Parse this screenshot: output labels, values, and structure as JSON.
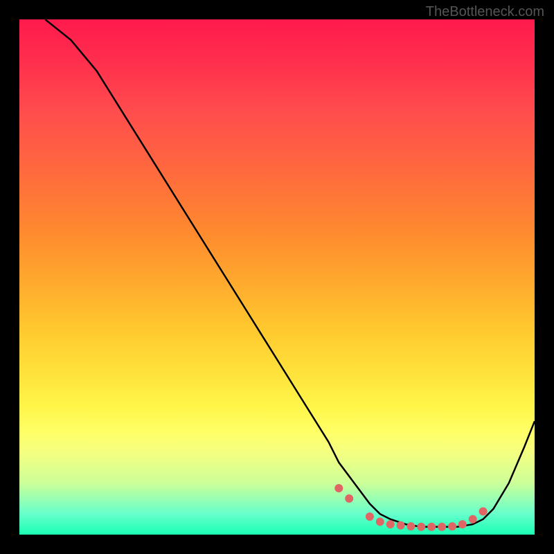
{
  "watermark": "TheBottleneck.com",
  "chart_data": {
    "type": "line",
    "title": "",
    "xlabel": "",
    "ylabel": "",
    "xlim": [
      0,
      100
    ],
    "ylim": [
      0,
      100
    ],
    "series": [
      {
        "name": "curve",
        "x": [
          5,
          10,
          15,
          20,
          25,
          30,
          35,
          40,
          45,
          50,
          55,
          60,
          62,
          65,
          68,
          70,
          72,
          75,
          78,
          80,
          82,
          85,
          88,
          90,
          92,
          95,
          98,
          100
        ],
        "y": [
          100,
          96,
          90,
          82,
          74,
          66,
          58,
          50,
          42,
          34,
          26,
          18,
          14,
          10,
          6,
          4,
          3,
          2,
          1.5,
          1.5,
          1.5,
          1.5,
          2,
          3,
          5,
          10,
          17,
          22
        ]
      }
    ],
    "markers": {
      "x": [
        62,
        64,
        68,
        70,
        72,
        74,
        76,
        78,
        80,
        82,
        84,
        86,
        88,
        90
      ],
      "y": [
        9,
        7,
        3.5,
        2.5,
        2,
        1.8,
        1.6,
        1.5,
        1.5,
        1.5,
        1.6,
        2,
        3,
        4.5
      ],
      "color": "#e06666"
    }
  }
}
